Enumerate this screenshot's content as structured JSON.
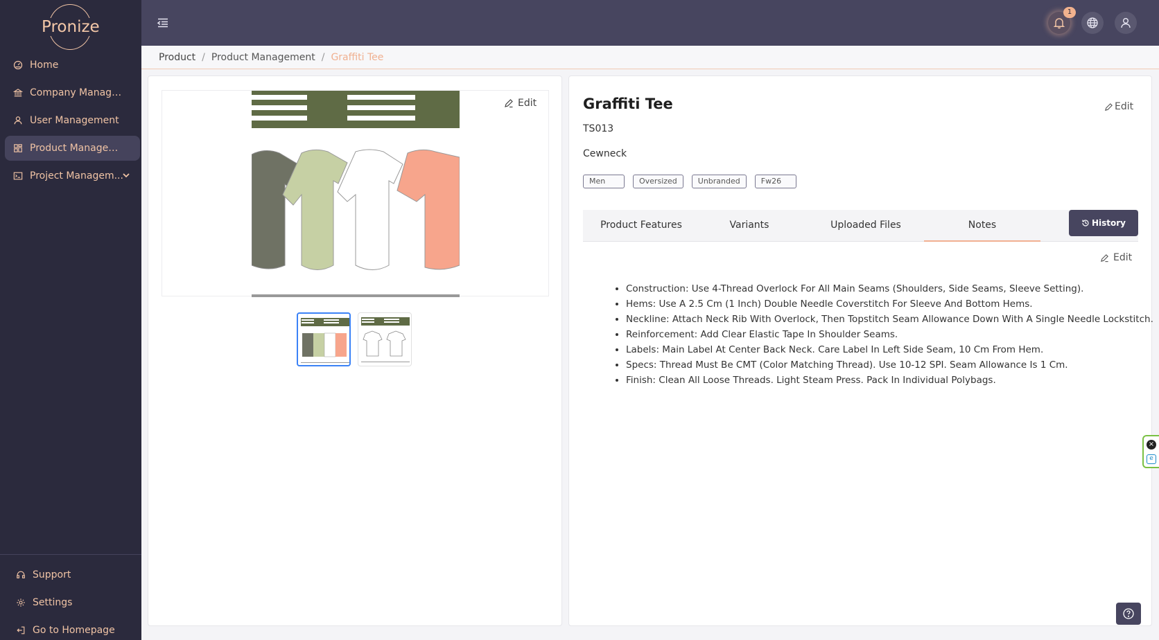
{
  "brand": {
    "logo_text": "Pronize"
  },
  "sidebar": {
    "items": [
      {
        "label": "Home",
        "icon": "dashboard-icon"
      },
      {
        "label": "Company Managem...",
        "icon": "bank-icon"
      },
      {
        "label": "User Management",
        "icon": "user-icon"
      },
      {
        "label": "Product Management",
        "icon": "grid-icon",
        "active": true
      },
      {
        "label": "Project Managem...",
        "icon": "terminal-icon"
      }
    ],
    "bottom": [
      {
        "label": "Support",
        "icon": "headset-icon"
      },
      {
        "label": "Settings",
        "icon": "gear-icon"
      },
      {
        "label": "Go to Homepage",
        "icon": "exit-icon"
      }
    ]
  },
  "topbar": {
    "notification_count": "1"
  },
  "breadcrumb": {
    "items": [
      "Product",
      "Product Management",
      "Graffiti Tee"
    ]
  },
  "gallery": {
    "edit_label": "Edit",
    "colors": [
      "#6f7264",
      "#c6d0a4",
      "#ffffff",
      "#f7a58c"
    ],
    "header_color": "#5f6b45"
  },
  "product": {
    "title": "Graffiti Tee",
    "edit_label": "Edit",
    "code": "TS013",
    "description": "Cewneck",
    "tags": [
      "Men",
      "Oversized",
      "Unbranded",
      "Fw26"
    ]
  },
  "tabs": {
    "items": [
      "Product Features",
      "Variants",
      "Uploaded Files",
      "Notes"
    ],
    "active": "Notes",
    "history_label": "History"
  },
  "notes": {
    "edit_label": "Edit",
    "items": [
      "Construction: Use 4-Thread Overlock For All Main Seams (Shoulders, Side Seams, Sleeve Setting).",
      "Hems: Use A 2.5 Cm (1 Inch) Double Needle Coverstitch For Sleeve And Bottom Hems.",
      "Neckline: Attach Neck Rib With Overlock, Then Topstitch Seam Allowance Down With A Single Needle Lockstitch.",
      "Reinforcement: Add Clear Elastic Tape In Shoulder Seams.",
      "Labels: Main Label At Center Back Neck. Care Label In Left Side Seam, 10 Cm From Hem.",
      "Specs: Thread Must Be CMT (Color Matching Thread). Use 10-12 SPI. Seam Allowance Is 1 Cm.",
      "Finish: Clean All Loose Threads. Light Steam Press. Pack In Individual Polybags."
    ]
  },
  "theme": {
    "sidebar_bg": "#2b2a3d",
    "accent": "#f2b28e",
    "header_bg": "#47455f"
  }
}
